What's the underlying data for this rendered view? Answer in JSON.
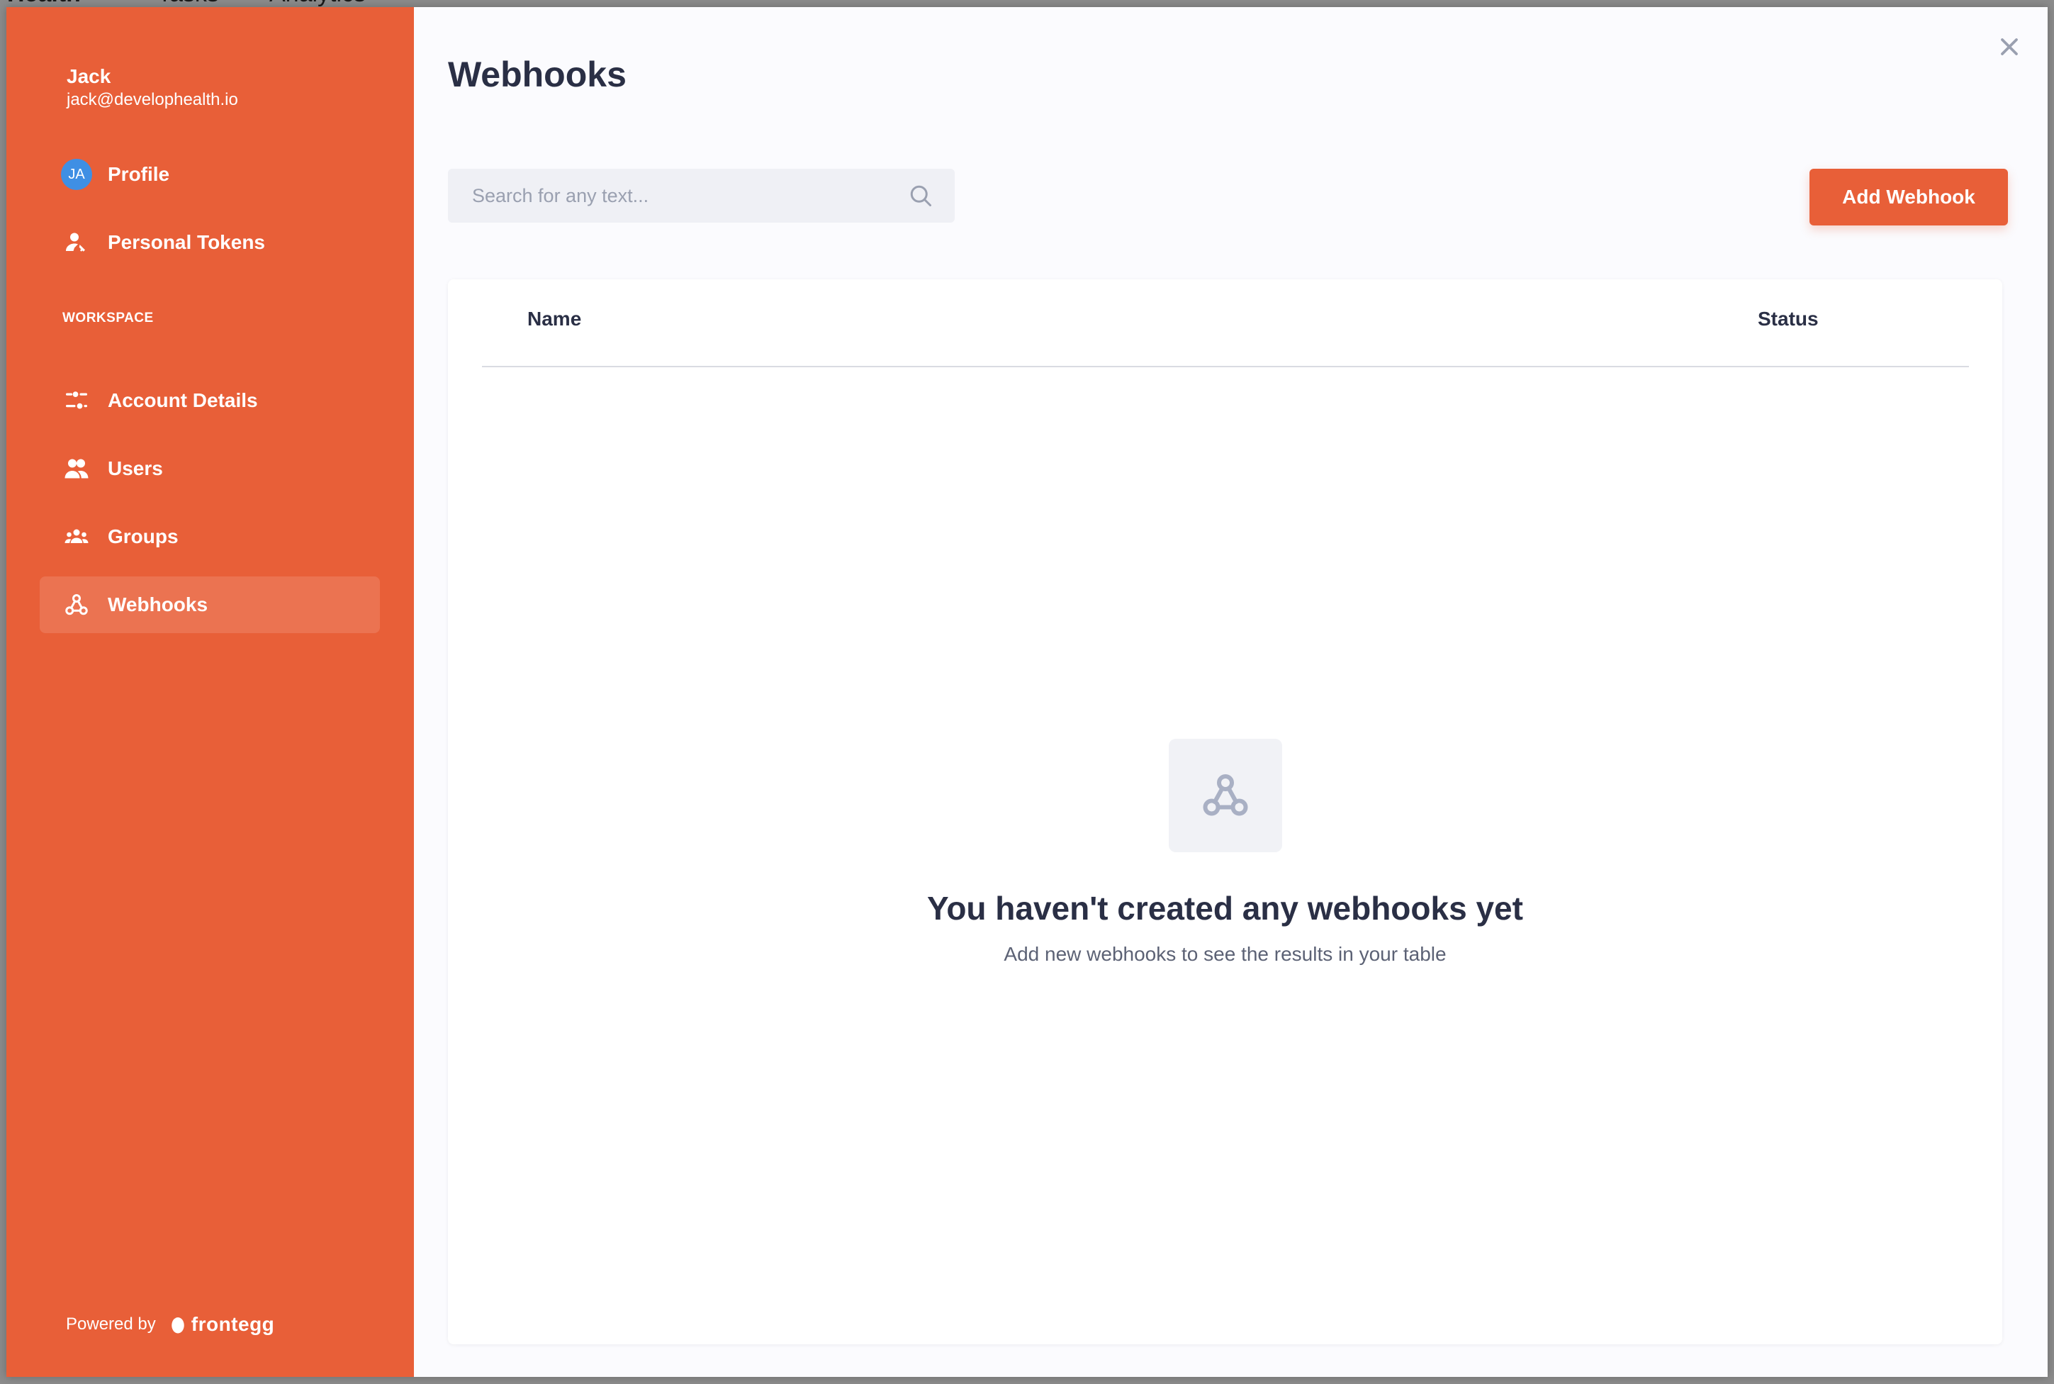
{
  "background_app": {
    "brand_fragment": "Health",
    "tab1": "Tasks",
    "tab2": "Analytics"
  },
  "user": {
    "name": "Jack",
    "email": "jack@develophealth.io",
    "initials": "JA"
  },
  "sidebar": {
    "personal_items": [
      {
        "label": "Profile",
        "icon": "avatar"
      },
      {
        "label": "Personal Tokens",
        "icon": "user-key-icon"
      }
    ],
    "section_label": "WORKSPACE",
    "workspace_items": [
      {
        "label": "Account Details",
        "icon": "sliders-icon"
      },
      {
        "label": "Users",
        "icon": "users-icon"
      },
      {
        "label": "Groups",
        "icon": "groups-icon"
      },
      {
        "label": "Webhooks",
        "icon": "webhook-icon",
        "active": true
      }
    ],
    "powered_by": "Powered by",
    "brand": "frontegg"
  },
  "main": {
    "title": "Webhooks",
    "search_placeholder": "Search for any text...",
    "add_button": "Add Webhook",
    "table": {
      "columns": [
        "Name",
        "Status"
      ]
    },
    "empty_state": {
      "icon": "webhook-icon",
      "title": "You haven't created any webhooks yet",
      "subtitle": "Add new webhooks to see the results in your table"
    }
  },
  "colors": {
    "accent": "#e85f38",
    "avatar": "#3f8fe4",
    "text_dark": "#2a2f45",
    "text_muted": "#5c6275",
    "icon_muted": "#a9b0c4"
  }
}
